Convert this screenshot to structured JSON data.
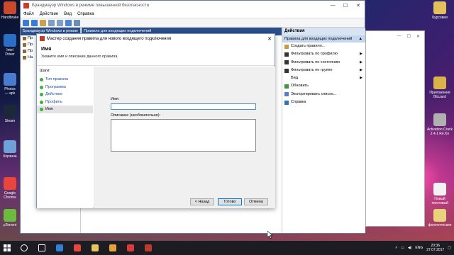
{
  "desktop": {
    "left_icons": [
      {
        "label": "Handbrake",
        "color": "#c94a2a"
      },
      {
        "label": "Intel\nDriver",
        "color": "#2b6fc4"
      },
      {
        "label": "Photos\n— apk",
        "color": "#4a7bd1"
      },
      {
        "label": "Steam",
        "color": "#1b2838"
      },
      {
        "label": "Корзина",
        "color": "#6fa3d8"
      },
      {
        "label": "Google\nChrome",
        "color": "#e8453c"
      },
      {
        "label": "µTorrent",
        "color": "#6dbb3e"
      }
    ],
    "right_icons": [
      {
        "label": "Курсовая",
        "color": "#e3c15a"
      },
      {
        "label": "Приложения\nBlizzard",
        "color": "#d9b24a"
      },
      {
        "label": "Activation.Crack\n2.4.1 Re.Kn",
        "color": "#b0b0b0"
      },
      {
        "label": "Новый\nтекстовый",
        "color": "#f2f2f2"
      },
      {
        "label": "фонетические",
        "color": "#e8d27a"
      }
    ]
  },
  "main_window": {
    "title": "Брандмауэр Windows в режиме повышенной безопасности",
    "controls": [
      "—",
      "☐",
      "✕"
    ],
    "menu": [
      "Файл",
      "Действие",
      "Вид",
      "Справка"
    ],
    "tree_header": "Брандмауэр Windows в режим",
    "tree_items": [
      "Пр",
      "Пр",
      "Пр",
      "На"
    ],
    "center_header": "Правила для входящих подключений"
  },
  "actions_panel": {
    "header": "Действия",
    "subheader": "Правила для входящих подключений",
    "subheader_arrow": "▲",
    "items": [
      {
        "label": "Создать правило...",
        "icon_color": "#c99a3c",
        "submenu": ""
      },
      {
        "label": "Фильтровать по профилю",
        "icon_color": "#333333",
        "submenu": "▶"
      },
      {
        "label": "Фильтровать по состоянию",
        "icon_color": "#333333",
        "submenu": "▶"
      },
      {
        "label": "Фильтровать по группе",
        "icon_color": "#333333",
        "submenu": "▶"
      },
      {
        "label": "Вид",
        "icon_color": "#ffffff",
        "submenu": "▶"
      },
      {
        "label": "Обновить",
        "icon_color": "#3a9a3a",
        "submenu": ""
      },
      {
        "label": "Экспортировать список...",
        "icon_color": "#5a7fbf",
        "submenu": ""
      },
      {
        "label": "Справка",
        "icon_color": "#2f6fc4",
        "submenu": ""
      }
    ]
  },
  "wizard": {
    "title": "Мастер создания правила для нового входящего подключения",
    "close": "✕",
    "heading": "Имя",
    "subtitle": "Укажите имя и описание данного правила.",
    "steps_header": "Шаги:",
    "steps": [
      "Тип правила",
      "Программа",
      "Действие",
      "Профиль",
      "Имя"
    ],
    "active_step": 4,
    "name_label": "Имя:",
    "name_value": "",
    "description_label": "Описание (необязательно):",
    "description_value": "",
    "back_button": "< Назад",
    "finish_button": "Готово",
    "cancel_button": "Отмена"
  },
  "right_window": {
    "controls": [
      "—",
      "☐",
      "✕"
    ]
  },
  "taskbar": {
    "language": "ENG",
    "time": "20:36",
    "date": "27.07.2017",
    "pinned": [
      {
        "name": "search",
        "color": "#ffffff"
      },
      {
        "name": "task-view",
        "color": "#ffffff"
      },
      {
        "name": "edge",
        "color": "#2f7fd6"
      },
      {
        "name": "yandex",
        "color": "#e8453c"
      },
      {
        "name": "explorer",
        "color": "#e8c25a"
      },
      {
        "name": "chrome",
        "color": "#e8a23c"
      },
      {
        "name": "app",
        "color": "#d93a3a"
      },
      {
        "name": "firewall",
        "color": "#c0392b"
      }
    ]
  }
}
